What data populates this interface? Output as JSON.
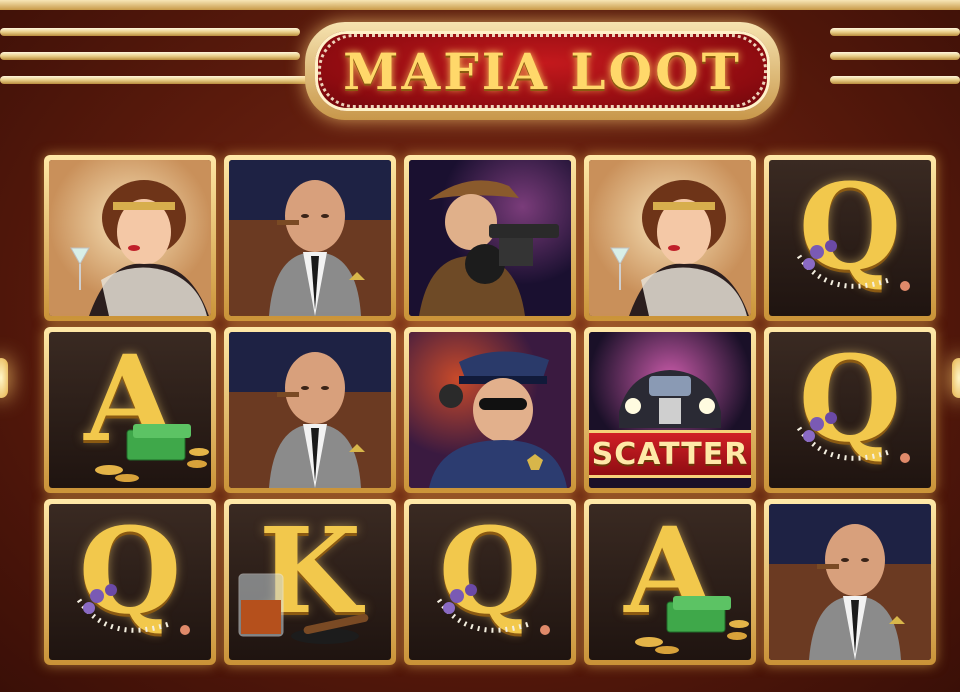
{
  "game": {
    "title": "MAFIA LOOT",
    "scatter_label": "SCATTER"
  },
  "reels": [
    [
      "flapper-woman",
      "mob-boss",
      "gangster-tommy-gun",
      "flapper-woman",
      "queen-symbol"
    ],
    [
      "ace-symbol",
      "mob-boss",
      "police-officer",
      "scatter-car",
      "queen-symbol"
    ],
    [
      "queen-symbol",
      "king-symbol",
      "queen-symbol",
      "ace-symbol",
      "mob-boss"
    ]
  ],
  "card_letters": {
    "ace": "A",
    "king": "K",
    "queen": "Q"
  },
  "colors": {
    "background": "#5a1a0c",
    "frame_gold": "#e9c46a",
    "logo_red": "#b3141a",
    "title_gold": "#ffd86a"
  }
}
